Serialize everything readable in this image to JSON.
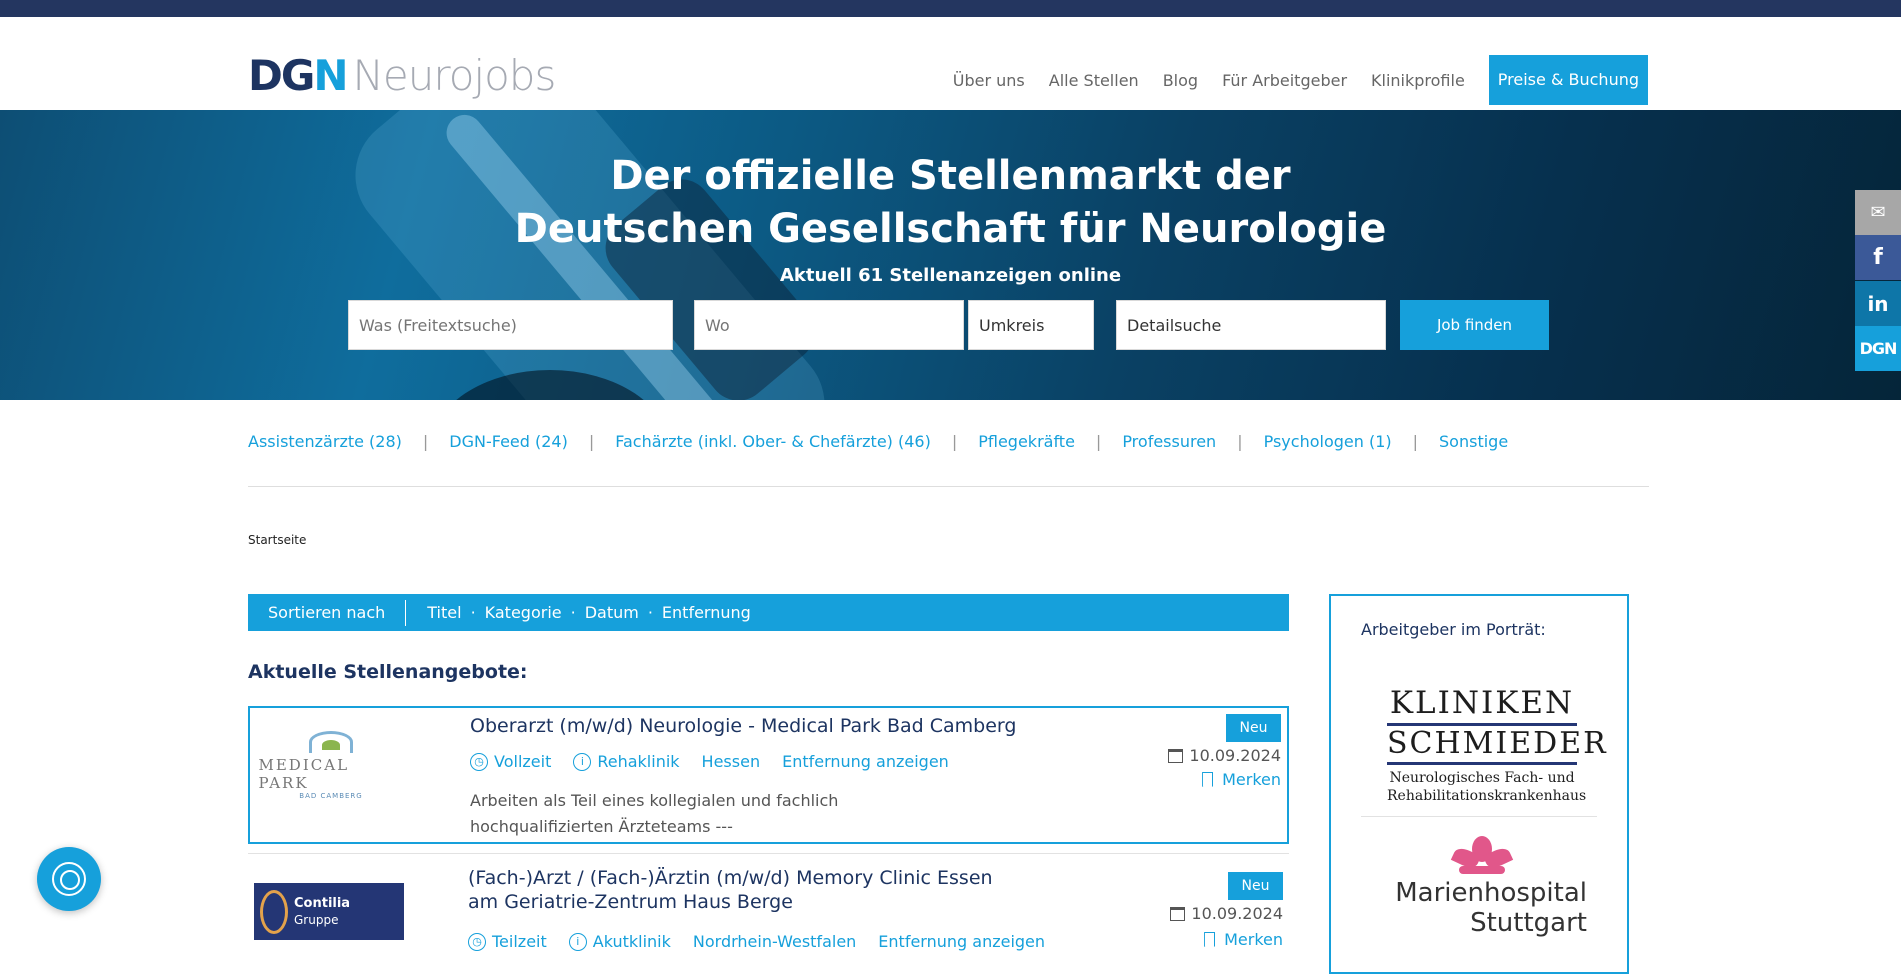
{
  "header": {
    "logo_dgn": "DG",
    "logo_n": "N",
    "logo_rest": "Neurojobs",
    "nav": [
      "Über uns",
      "Alle Stellen",
      "Blog",
      "Für Arbeitgeber",
      "Klinikprofile"
    ],
    "cta": "Preise & Buchung"
  },
  "hero": {
    "title_line1": "Der offizielle Stellenmarkt der",
    "title_line2": "Deutschen Gesellschaft für Neurologie",
    "subtitle": "Aktuell 61 Stellenanzeigen online",
    "search": {
      "what_placeholder": "Was (Freitextsuche)",
      "where_placeholder": "Wo",
      "radius": "Umkreis",
      "detail": "Detailsuche",
      "button": "Job finden"
    }
  },
  "social": {
    "mail": "✉",
    "facebook": "f",
    "linkedin": "in",
    "dgn": "DGN"
  },
  "categories": [
    "Assistenzärzte (28)",
    "DGN-Feed (24)",
    "Fachärzte (inkl. Ober- & Chefärzte) (46)",
    "Pflegekräfte",
    "Professuren",
    "Psychologen (1)",
    "Sonstige"
  ],
  "breadcrumb": "Startseite",
  "sort": {
    "label": "Sortieren nach",
    "options": [
      "Titel",
      "Kategorie",
      "Datum",
      "Entfernung"
    ]
  },
  "section_title": "Aktuelle Stellenangebote:",
  "jobs": [
    {
      "logo_name": "MEDICAL PARK",
      "logo_sub": "BAD CAMBERG",
      "title": "Oberarzt (m/w/d) Neurologie - Medical Park Bad Camberg",
      "tags": [
        "Vollzeit",
        "Rehaklinik",
        "Hessen",
        "Entfernung anzeigen"
      ],
      "desc": "Arbeiten als Teil eines kollegialen und fachlich hochqualifizierten Ärzteteams ---",
      "badge": "Neu",
      "date": "10.09.2024",
      "merken": "Merken"
    },
    {
      "logo_name": "Contilia",
      "logo_sub": "Gruppe",
      "title": "(Fach-)Arzt / (Fach-)Ärztin (m/w/d) Memory Clinic Essen am Geriatrie-Zentrum Haus Berge",
      "tags": [
        "Teilzeit",
        "Akutklinik",
        "Nordrhein-Westfalen",
        "Entfernung anzeigen"
      ],
      "badge": "Neu",
      "date": "10.09.2024",
      "merken": "Merken"
    }
  ],
  "aside": {
    "title": "Arbeitgeber im Porträt:",
    "kliniken_l1": "KLINIKEN",
    "kliniken_l2": "SCHMIEDER",
    "kliniken_l3": "Neurologisches Fach- und Rehabilitationskrankenhaus",
    "marien_l1": "Marienhospital",
    "marien_l2": "Stuttgart"
  },
  "colors": {
    "brand_blue": "#16a0db",
    "navy": "#1d3461",
    "topbar": "#243660"
  }
}
